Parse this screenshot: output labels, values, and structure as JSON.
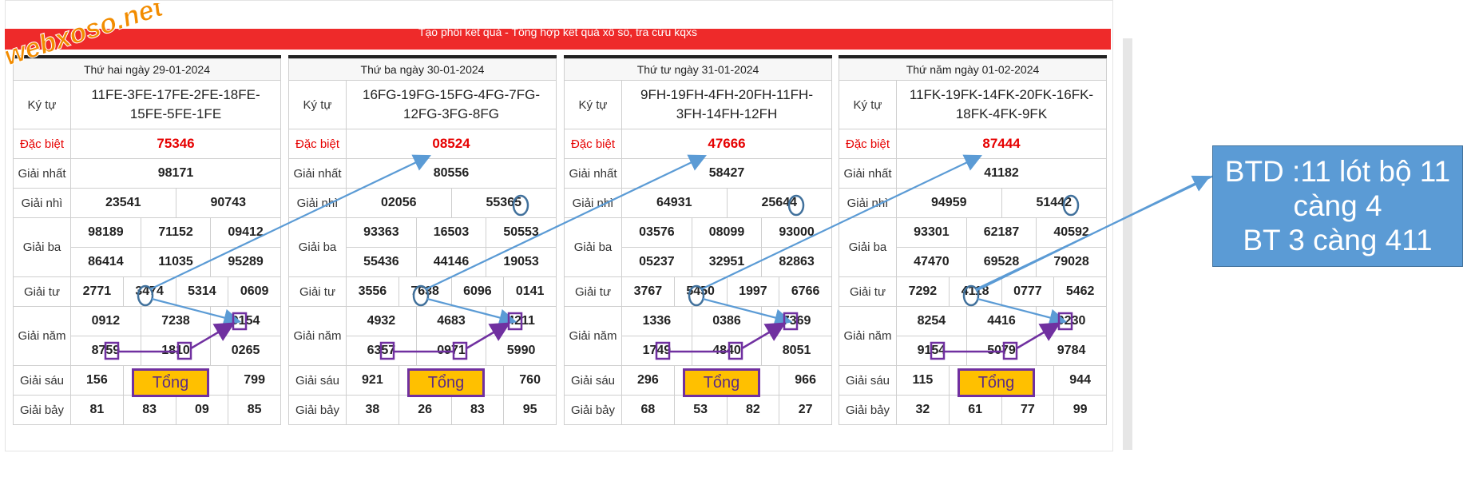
{
  "site": {
    "logo_text": "webxoso.net",
    "header_text": "Tạo phôi kết quả - Tổng hợp kết quả xổ số, tra cứu kqxs"
  },
  "labels": {
    "ky_tu": "Ký tự",
    "dac_biet": "Đặc biệt",
    "giai_nhat": "Giải nhất",
    "giai_nhi": "Giải nhì",
    "giai_ba": "Giải ba",
    "giai_tu": "Giải tư",
    "giai_nam": "Giải năm",
    "giai_sau": "Giải sáu",
    "giai_bay": "Giải bảy"
  },
  "tong_label": "Tổng",
  "tables": [
    {
      "date": "Thứ hai ngày 29-01-2024",
      "kytu_line1": "11FE-3FE-17FE-2FE-18FE-",
      "kytu_line2": "15FE-5FE-1FE",
      "dac_biet": "75346",
      "giai_nhat": "98171",
      "giai_nhi": [
        "23541",
        "90743"
      ],
      "giai_ba": [
        "98189",
        "71152",
        "09412",
        "86414",
        "11035",
        "95289"
      ],
      "giai_tu": [
        "2771",
        "3474",
        "5314",
        "0609"
      ],
      "giai_nam": [
        "0912",
        "7238",
        "9154",
        "8759",
        "1810",
        "0265"
      ],
      "giai_sau": [
        "156",
        "799"
      ],
      "giai_bay": [
        "81",
        "83",
        "09",
        "85"
      ]
    },
    {
      "date": "Thứ ba ngày 30-01-2024",
      "kytu_line1": "16FG-19FG-15FG-4FG-7FG-",
      "kytu_line2": "12FG-3FG-8FG",
      "dac_biet": "08524",
      "giai_nhat": "80556",
      "giai_nhi": [
        "02056",
        "55365"
      ],
      "giai_ba": [
        "93363",
        "16503",
        "50553",
        "55436",
        "44146",
        "19053"
      ],
      "giai_tu": [
        "3556",
        "7638",
        "6096",
        "0141"
      ],
      "giai_nam": [
        "4932",
        "4683",
        "4211",
        "6357",
        "0971",
        "5990"
      ],
      "giai_sau": [
        "921",
        "760"
      ],
      "giai_bay": [
        "38",
        "26",
        "83",
        "95"
      ]
    },
    {
      "date": "Thứ tư ngày 31-01-2024",
      "kytu_line1": "9FH-19FH-4FH-20FH-11FH-",
      "kytu_line2": "3FH-14FH-12FH",
      "dac_biet": "47666",
      "giai_nhat": "58427",
      "giai_nhi": [
        "64931",
        "25644"
      ],
      "giai_ba": [
        "03576",
        "08099",
        "93000",
        "05237",
        "32951",
        "82863"
      ],
      "giai_tu": [
        "3767",
        "5450",
        "1997",
        "6766"
      ],
      "giai_nam": [
        "1336",
        "0386",
        "7369",
        "1749",
        "4840",
        "8051"
      ],
      "giai_sau": [
        "296",
        "966"
      ],
      "giai_bay": [
        "68",
        "53",
        "82",
        "27"
      ]
    },
    {
      "date": "Thứ năm ngày 01-02-2024",
      "kytu_line1": "11FK-19FK-14FK-20FK-16FK-",
      "kytu_line2": "18FK-4FK-9FK",
      "dac_biet": "87444",
      "giai_nhat": "41182",
      "giai_nhi": [
        "94959",
        "51442"
      ],
      "giai_ba": [
        "93301",
        "62187",
        "40592",
        "47470",
        "69528",
        "79028"
      ],
      "giai_tu": [
        "7292",
        "4118",
        "0777",
        "5462"
      ],
      "giai_nam": [
        "8254",
        "4416",
        "0230",
        "9154",
        "5079",
        "9784"
      ],
      "giai_sau": [
        "115",
        "944"
      ],
      "giai_bay": [
        "32",
        "61",
        "77",
        "99"
      ]
    }
  ],
  "callout": {
    "line1": "BTD :11 lót bộ 11",
    "line2": "càng 4",
    "line3": "BT 3 càng 411"
  },
  "colors": {
    "red": "#e60000",
    "header_red": "#ee2a2a",
    "highlight_fill": "#ffc000",
    "purple": "#7030a0",
    "arrow_blue": "#5b9bd5",
    "circle_blue": "#41719c"
  }
}
